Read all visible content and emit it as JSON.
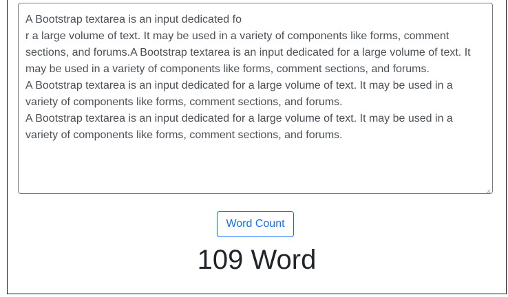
{
  "textarea": {
    "lines": [
      "A Bootstrap textarea is an input dedicated fo",
      "r a large volume of text. It may be used in a variety of components like forms, comment",
      "sections, and forums.A Bootstrap textarea is an input dedicated for a large volume of text. It",
      "may be used in a variety of components like forms, comment sections, and forums.",
      "A Bootstrap textarea is an input dedicated for a large volume of text. It may be used in a",
      "variety of components like forms, comment sections, and forums.",
      "A Bootstrap textarea is an input dedicated for a large volume of text. It may be used in a",
      "variety of components like forms, comment sections, and forums."
    ],
    "resize_icon": "resize-grip-icon"
  },
  "button": {
    "label": "Word Count",
    "color": "#0d6efd"
  },
  "result": {
    "text": "109 Word"
  },
  "colors": {
    "text": "#495057",
    "heading": "#212529",
    "border": "#7a7a7a"
  }
}
